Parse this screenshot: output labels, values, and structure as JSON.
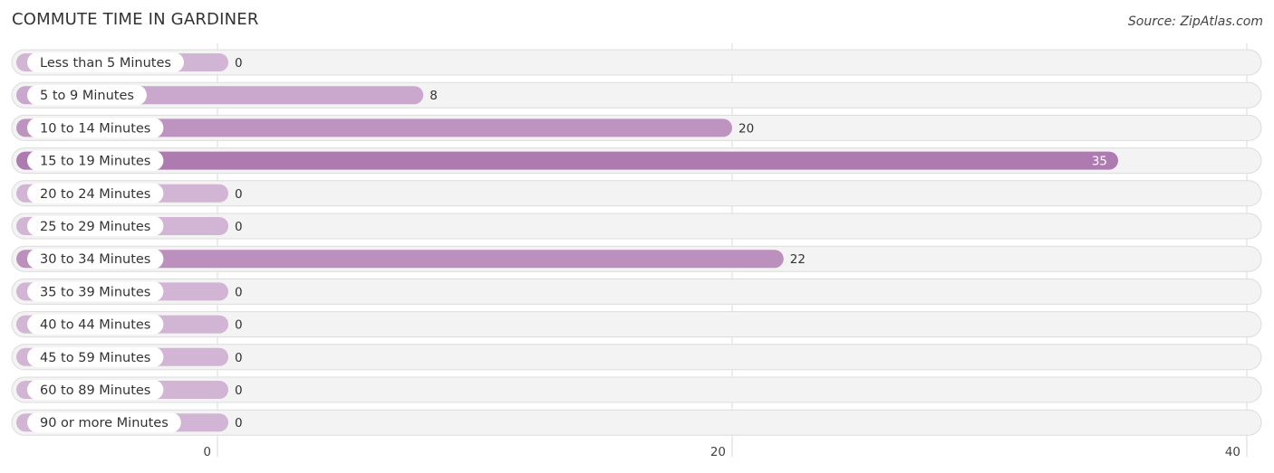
{
  "header": {
    "title": "COMMUTE TIME IN GARDINER",
    "source": "Source: ZipAtlas.com"
  },
  "chart_data": {
    "type": "bar",
    "orientation": "horizontal",
    "title": "COMMUTE TIME IN GARDINER",
    "xlabel": "",
    "ylabel": "",
    "categories": [
      "Less than 5 Minutes",
      "5 to 9 Minutes",
      "10 to 14 Minutes",
      "15 to 19 Minutes",
      "20 to 24 Minutes",
      "25 to 29 Minutes",
      "30 to 34 Minutes",
      "35 to 39 Minutes",
      "40 to 44 Minutes",
      "45 to 59 Minutes",
      "60 to 89 Minutes",
      "90 or more Minutes"
    ],
    "values": [
      0,
      8,
      20,
      35,
      0,
      0,
      22,
      0,
      0,
      0,
      0,
      0
    ],
    "xlim": [
      0,
      40
    ],
    "x_ticks": [
      0,
      20,
      40
    ],
    "x_tick_labels": [
      "0",
      "20",
      "40"
    ],
    "grid": true,
    "bar_color_light": "#d2b4d4",
    "bar_color_dark": "#ad7bb0",
    "legend": null
  }
}
